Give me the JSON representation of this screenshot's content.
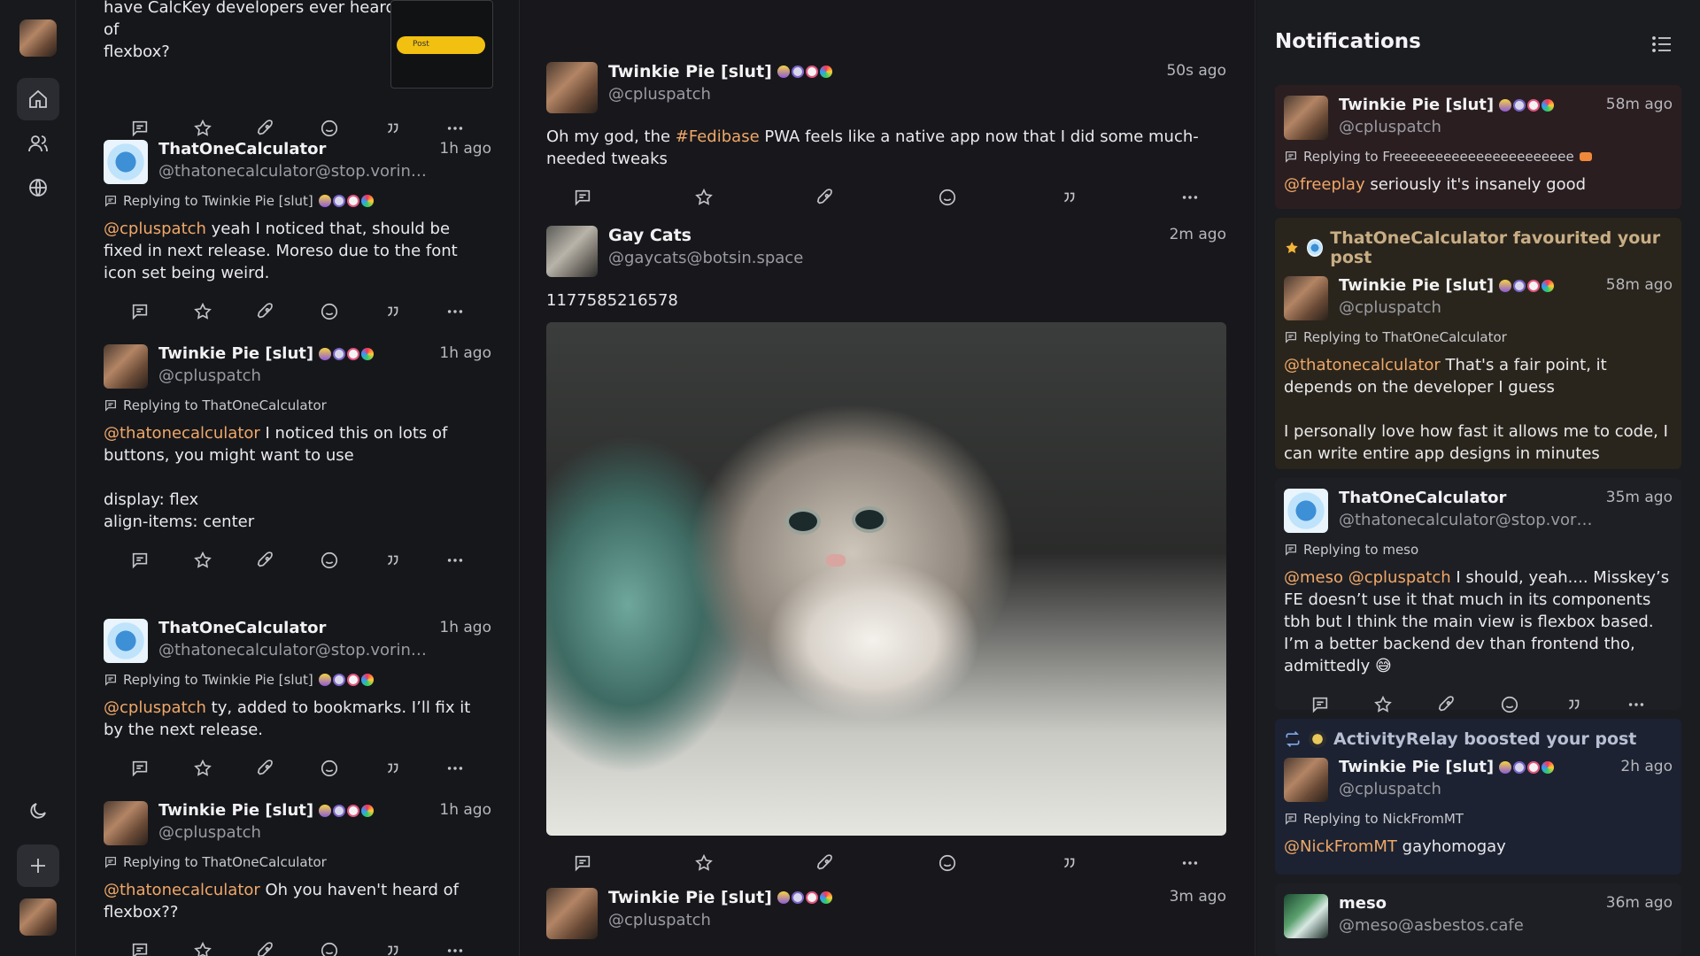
{
  "sidebar": {
    "avatar_top": "account avatar",
    "nav": [
      {
        "name": "home-icon",
        "label": "Home"
      },
      {
        "name": "people-icon",
        "label": "Social"
      },
      {
        "name": "globe-icon",
        "label": "Global"
      }
    ]
  },
  "left_column": {
    "top_fragment": "have CalcKey developers ever heard of\nflexbox?",
    "top_image_pill": "Post",
    "posts": [
      {
        "author": "ThatOneCalculator",
        "handle": "@thatonecalculator@stop.voring.me",
        "time": "1h ago",
        "reply_to": "Replying to Twinkie Pie [slut]",
        "mention": "@cpluspatch",
        "text": " yeah I noticed that, should be fixed in next release. Moreso due to the font icon set being weird."
      },
      {
        "author": "Twinkie Pie [slut]",
        "handle": "@cpluspatch",
        "time": "1h ago",
        "reply_to": "Replying to ThatOneCalculator",
        "mention": "@thatonecalculator",
        "text": " I noticed this on lots of buttons, you might want to use\n\ndisplay: flex\nalign-items: center"
      },
      {
        "author": "ThatOneCalculator",
        "handle": "@thatonecalculator@stop.voring.me",
        "time": "1h ago",
        "reply_to": "Replying to Twinkie Pie [slut]",
        "mention": "@cpluspatch",
        "text": " ty, added to bookmarks. I’ll fix it by the next release."
      },
      {
        "author": "Twinkie Pie [slut]",
        "handle": "@cpluspatch",
        "time": "1h ago",
        "reply_to": "Replying to ThatOneCalculator",
        "mention": "@thatonecalculator",
        "text": " Oh you haven't heard of flexbox??"
      }
    ]
  },
  "middle_column": {
    "posts": [
      {
        "author": "Twinkie Pie [slut]",
        "handle": "@cpluspatch",
        "time": "50s ago",
        "text_before": "Oh my god, the ",
        "hashtag": "#Fedibase",
        "text_after": " PWA feels like a native app now that I did some much-needed tweaks"
      },
      {
        "author": "Gay Cats",
        "handle": "@gaycats@botsin.space",
        "time": "2m ago",
        "text": "1177585216578",
        "image_alt": "kitten photo"
      },
      {
        "author": "Twinkie Pie [slut]",
        "handle": "@cpluspatch",
        "time": "3m ago"
      }
    ]
  },
  "notifications": {
    "title": "Notifications",
    "items": [
      {
        "author": "Twinkie Pie [slut]",
        "handle": "@cpluspatch",
        "time": "58m ago",
        "reply_to": "Replying to Freeeeeeeeeeeeeeeeeeeeee",
        "mention": "@freeplay",
        "text": " seriously it's insanely good"
      },
      {
        "event": "ThatOneCalculator favourited your post",
        "author": "Twinkie Pie [slut]",
        "handle": "@cpluspatch",
        "time": "58m ago",
        "reply_to": "Replying to ThatOneCalculator",
        "mention": "@thatonecalculator",
        "text": " That's a fair point, it depends on the developer I guess\n\nI personally love how fast it allows me to code, I can write entire app designs in minutes"
      },
      {
        "author": "ThatOneCalculator",
        "handle": "@thatonecalculator@stop.voring....",
        "time": "35m ago",
        "reply_to": "Replying to meso",
        "mention": "@meso @cpluspatch",
        "text": " I should, yeah.... Misskey’s FE doesn’t use it that much in its components tbh but I think the main view is flexbox based. I’m a better backend dev than frontend tho, admittedly 😅"
      },
      {
        "event": "ActivityRelay boosted your post",
        "author": "Twinkie Pie [slut]",
        "handle": "@cpluspatch",
        "time": "2h ago",
        "reply_to": "Replying to NickFromMT",
        "mention": "@NickFromMT",
        "text": " gayhomogay"
      },
      {
        "author": "meso",
        "handle": "@meso@asbestos.cafe",
        "time": "36m ago"
      }
    ]
  },
  "colors": {
    "accent": "#f0a868",
    "background": "#16171b",
    "favourite_card": "#2a251c",
    "boost_card": "#1c2231",
    "reply_card": "#2a1e20"
  }
}
